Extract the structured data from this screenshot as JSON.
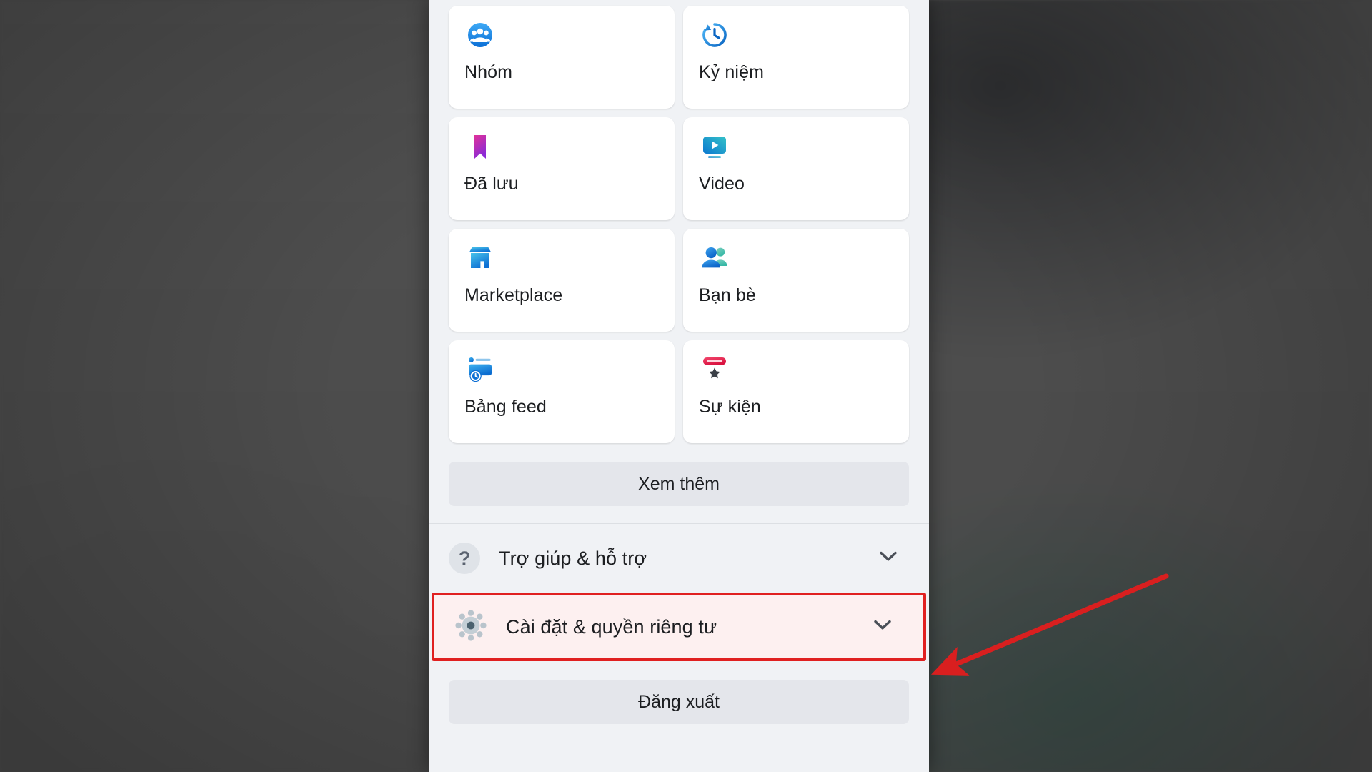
{
  "background": {
    "color": "#4e4e4e",
    "description": "blurred dark gray backdrop"
  },
  "panel": {
    "bg_color": "#f0f2f5",
    "card_bg": "#ffffff"
  },
  "menu_grid": [
    {
      "label": "Nhóm",
      "icon": "groups-icon"
    },
    {
      "label": "Kỷ niệm",
      "icon": "memories-clock-icon"
    },
    {
      "label": "Đã lưu",
      "icon": "saved-bookmark-icon"
    },
    {
      "label": "Video",
      "icon": "video-icon"
    },
    {
      "label": "Marketplace",
      "icon": "marketplace-storefront-icon"
    },
    {
      "label": "Bạn bè",
      "icon": "friends-icon"
    },
    {
      "label": "Bảng feed",
      "icon": "feeds-icon"
    },
    {
      "label": "Sự kiện",
      "icon": "events-calendar-icon"
    }
  ],
  "see_more": {
    "label": "Xem thêm"
  },
  "list_rows": [
    {
      "label": "Trợ giúp & hỗ trợ",
      "icon": "question-mark-icon",
      "chevron": "chevron-down-icon",
      "highlighted": false
    },
    {
      "label": "Cài đặt & quyền riêng tư",
      "icon": "gear-icon",
      "chevron": "chevron-down-icon",
      "highlighted": true
    }
  ],
  "logout": {
    "label": "Đăng xuất"
  },
  "annotation": {
    "highlight_color": "#e02020",
    "arrow_color": "#d91f1f",
    "arrow_target": "Cài đặt & quyền riêng tư"
  }
}
